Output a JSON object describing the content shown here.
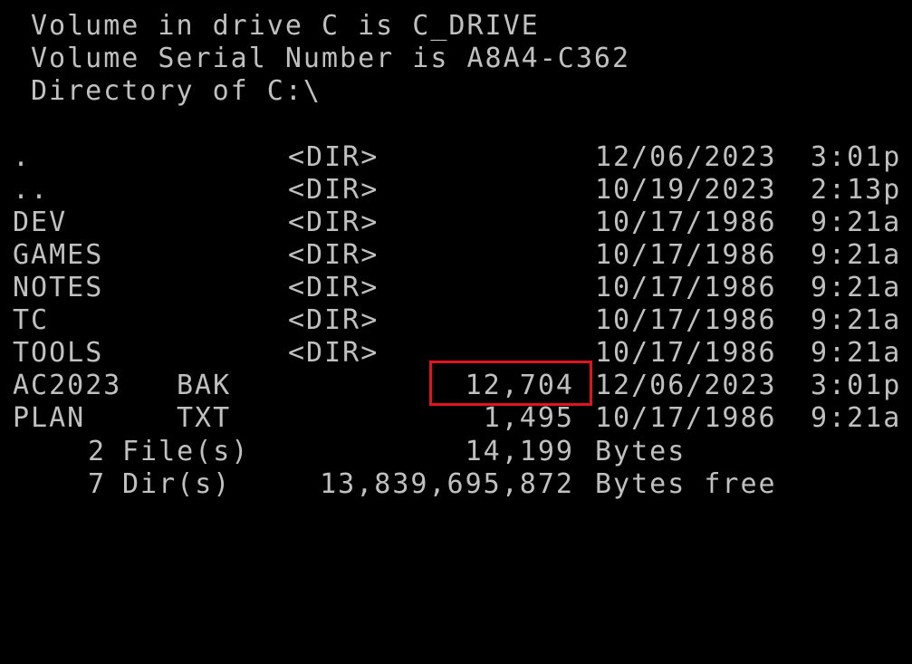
{
  "header": {
    "volume_line": "Volume in drive C is C_DRIVE",
    "serial_line": "Volume Serial Number is A8A4-C362",
    "directory_line": "Directory of C:\\"
  },
  "entries": [
    {
      "name": ".",
      "ext": "",
      "dir": "<DIR>",
      "size": "",
      "date": "12/06/2023",
      "time": "3:01p"
    },
    {
      "name": "..",
      "ext": "",
      "dir": "<DIR>",
      "size": "",
      "date": "10/19/2023",
      "time": "2:13p"
    },
    {
      "name": "DEV",
      "ext": "",
      "dir": "<DIR>",
      "size": "",
      "date": "10/17/1986",
      "time": "9:21a"
    },
    {
      "name": "GAMES",
      "ext": "",
      "dir": "<DIR>",
      "size": "",
      "date": "10/17/1986",
      "time": "9:21a"
    },
    {
      "name": "NOTES",
      "ext": "",
      "dir": "<DIR>",
      "size": "",
      "date": "10/17/1986",
      "time": "9:21a"
    },
    {
      "name": "TC",
      "ext": "",
      "dir": "<DIR>",
      "size": "",
      "date": "10/17/1986",
      "time": "9:21a"
    },
    {
      "name": "TOOLS",
      "ext": "",
      "dir": "<DIR>",
      "size": "",
      "date": "10/17/1986",
      "time": "9:21a"
    },
    {
      "name": "AC2023",
      "ext": "BAK",
      "dir": "",
      "size": "12,704",
      "date": "12/06/2023",
      "time": "3:01p"
    },
    {
      "name": "PLAN",
      "ext": "TXT",
      "dir": "",
      "size": "1,495",
      "date": "10/17/1986",
      "time": "9:21a"
    }
  ],
  "summary": {
    "files_count": "2",
    "files_label": "File(s)",
    "files_bytes": "14,199",
    "files_unit": "Bytes",
    "dirs_count": "7",
    "dirs_label": "Dir(s)",
    "dirs_bytes": "13,839,695,872",
    "dirs_unit": "Bytes free"
  },
  "colors": {
    "background": "#000000",
    "text": "#c0c0c0",
    "highlight": "#e0141e"
  }
}
